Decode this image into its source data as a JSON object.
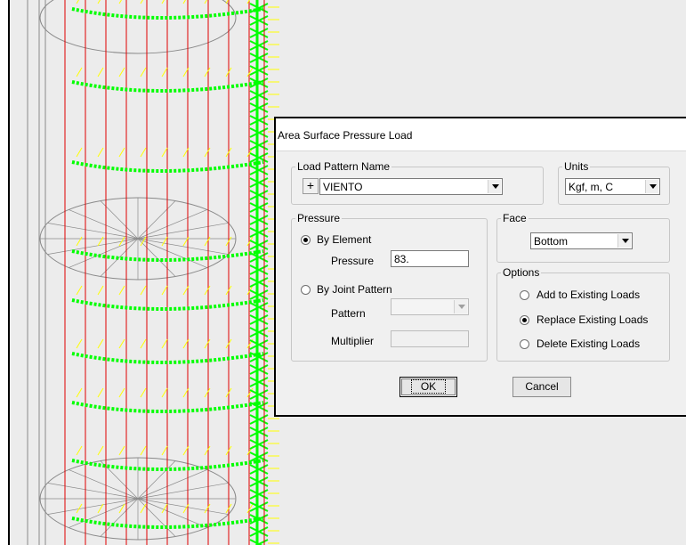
{
  "dialog": {
    "title": "Area Surface Pressure Load",
    "load_pattern": {
      "legend": "Load Pattern Name",
      "add_label": "+",
      "value": "VIENTO"
    },
    "units": {
      "legend": "Units",
      "value": "Kgf, m, C"
    },
    "pressure": {
      "legend": "Pressure",
      "by_element_label": "By Element",
      "by_element_selected": true,
      "pressure_label": "Pressure",
      "pressure_value": "83.",
      "by_joint_label": "By Joint Pattern",
      "by_joint_selected": false,
      "pattern_label": "Pattern",
      "pattern_value": "",
      "multiplier_label": "Multiplier",
      "multiplier_value": ""
    },
    "face": {
      "legend": "Face",
      "value": "Bottom"
    },
    "options": {
      "legend": "Options",
      "items": [
        {
          "label": "Add to Existing Loads",
          "selected": false
        },
        {
          "label": "Replace Existing Loads",
          "selected": true
        },
        {
          "label": "Delete Existing Loads",
          "selected": false
        }
      ]
    },
    "ok_label": "OK",
    "cancel_label": "Cancel"
  },
  "colors": {
    "frame_lines": "#e00000",
    "load_arrows": "#ffff00",
    "area_objects": "#00ff00",
    "mesh_lines": "#8a8a8a"
  }
}
